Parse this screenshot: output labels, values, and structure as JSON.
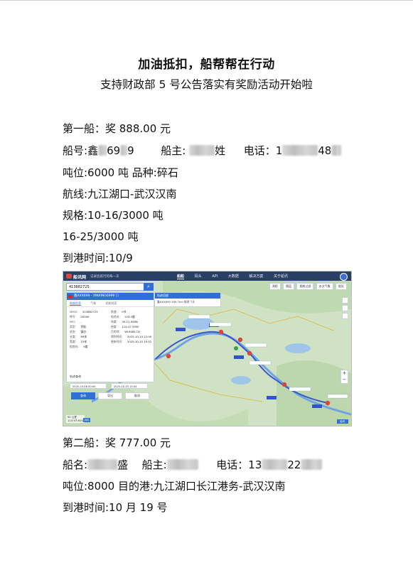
{
  "document": {
    "title": "加油抵扣，船帮帮在行动",
    "subtitle": "支持财政部 5 号公告落实有奖励活动开始啦"
  },
  "ship1": {
    "award": "第一船：奖 888.00 元",
    "ship_no_label": "船号:",
    "ship_no_visible_a": "鑫",
    "ship_no_visible_b": "69",
    "ship_no_visible_c": "9",
    "owner_label": "船主:",
    "owner_visible": "姓",
    "phone_label": "电话：",
    "phone_visible_a": "1",
    "phone_visible_b": "48",
    "tonnage_grade": "吨位:6000 吨   品种:碎石",
    "route": "航线:九江湖口-武汉汉南",
    "spec1": "规格:10-16/3000 吨",
    "spec2": "16-25/3000 吨",
    "arrival": "到港时间:10/9"
  },
  "ship2": {
    "award": "第二船：奖 777.00 元",
    "name_label": "船名:",
    "name_visible": "盛",
    "owner_label": "船主:",
    "phone_label": "电话：",
    "phone_visible_a": "13",
    "phone_visible_b": "22",
    "tonnage_dest": "吨位:8000      目的港:九江湖口长江港务-武汉汉南",
    "arrival": "到港时间:10 月 19 号"
  },
  "map": {
    "brand": "船讯网",
    "slogan": "记录您航行的每一天",
    "nav": [
      "船舶",
      "码头",
      "API",
      "大数据",
      "解决方案",
      "关于船讯"
    ],
    "search_value": "413882725",
    "panel_header": "鑫XXX699 - XINXING6999 ☐",
    "tabs": [
      "船舶信息",
      "气象",
      "船舶档案"
    ],
    "fields": [
      {
        "k": "MMSI：",
        "v": "413882725"
      },
      {
        "k": "呼号：",
        "v": "00000"
      },
      {
        "k": "IMO：",
        "v": "-"
      },
      {
        "k": "类型：",
        "v": "货船"
      },
      {
        "k": "状态：",
        "v": "锚泊"
      },
      {
        "k": "长度：",
        "v": "89米"
      },
      {
        "k": "宽度：",
        "v": "15米"
      },
      {
        "k": "船首向：",
        "v": "9度"
      },
      {
        "k": "航速：",
        "v": "0节"
      },
      {
        "k": "船迹向：",
        "v": "223.3度"
      },
      {
        "k": "纬度：",
        "v": "30-21.956N"
      },
      {
        "k": "经度：",
        "v": "114-07.595E"
      },
      {
        "k": "目的地：",
        "v": "WUHAN CN"
      },
      {
        "k": "预到时间：",
        "v": "2025-10-14 22:00"
      },
      {
        "k": "更新时间：",
        "v": "2025-10-15 15:52"
      }
    ],
    "track_title": "轨迹查询",
    "date_from": "2025-10-08 00:00",
    "date_to": "2025-10-15 15:04",
    "buttons": [
      "查询",
      "导出",
      "取消"
    ],
    "track_panel_head": "轨迹回放",
    "track_panel_row": "鑫XXX699    389.7km    耗时 7天",
    "tools": [
      "测距",
      "图层",
      "船舶过滤",
      "水文气象",
      "船队"
    ],
    "scale_text": "50 公里",
    "coord_text": "114°47.85'E",
    "ais_text": "AIS",
    "logo_text": "船讯",
    "colors": {
      "nav_bg": "#2a3f66",
      "river": "#6fa3e6",
      "track": "#3a56c9",
      "marker": "#d8473a",
      "land": "#cfe3c4"
    }
  }
}
